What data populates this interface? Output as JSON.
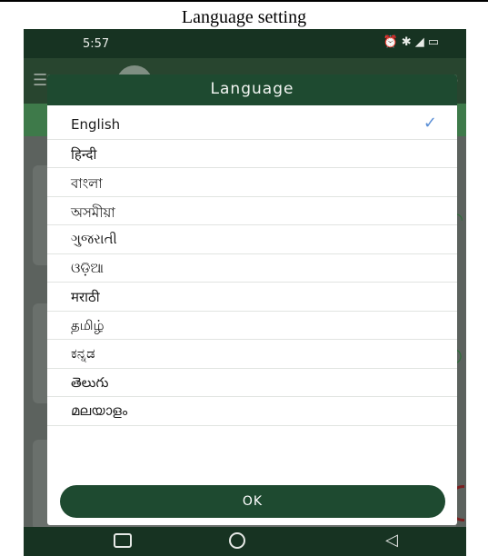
{
  "caption": "Language setting",
  "status": {
    "time": "5:57",
    "icons": [
      "alarm-icon",
      "bluetooth-icon",
      "vowifi-icon",
      "signal-icon",
      "battery-icon"
    ]
  },
  "dialog": {
    "title": "Language",
    "languages": [
      {
        "label": "English",
        "selected": true
      },
      {
        "label": "हिन्दी",
        "selected": false
      },
      {
        "label": "বাংলা",
        "selected": false
      },
      {
        "label": "অসমীয়া",
        "selected": false
      },
      {
        "label": "ગુજરાતી",
        "selected": false
      },
      {
        "label": "ଓଡ଼ିଆ",
        "selected": false
      },
      {
        "label": "मराठी",
        "selected": false
      },
      {
        "label": "தமிழ்",
        "selected": false
      },
      {
        "label": "ಕನ್ನಡ",
        "selected": false
      },
      {
        "label": "తెలుగు",
        "selected": false
      },
      {
        "label": "മലയാളം",
        "selected": false
      }
    ],
    "ok_label": "OK"
  },
  "colors": {
    "dialog_header": "#1e4a30",
    "ok_button": "#1e4a30",
    "check": "#5b8fd6",
    "statusbar": "#173322"
  }
}
